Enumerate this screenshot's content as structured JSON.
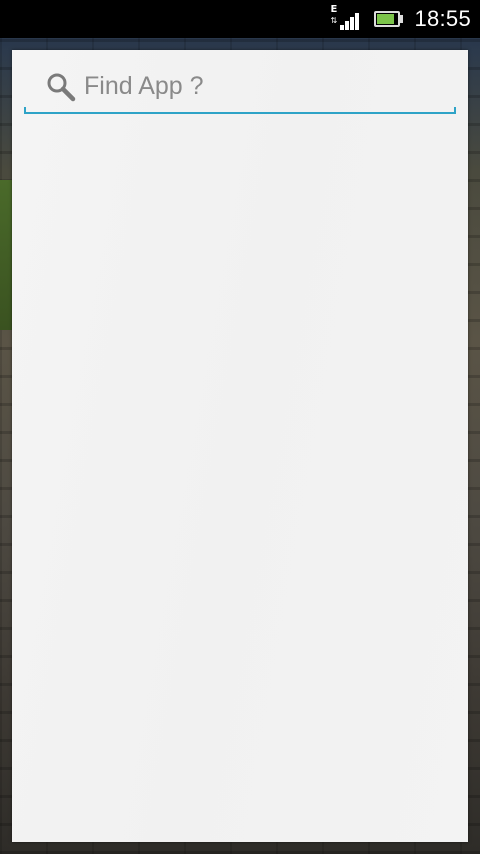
{
  "status_bar": {
    "network_type": "E",
    "time": "18:55",
    "icons": [
      "signal-icon",
      "battery-icon"
    ],
    "battery_level": 0.85
  },
  "search": {
    "placeholder": "Find App ?",
    "value": ""
  },
  "app_list": {
    "items": []
  },
  "colors": {
    "accent": "#2ea3c7",
    "panel_background": "#f2f2f2",
    "status_bar_background": "#000000",
    "battery_fill": "#7cc44a"
  }
}
